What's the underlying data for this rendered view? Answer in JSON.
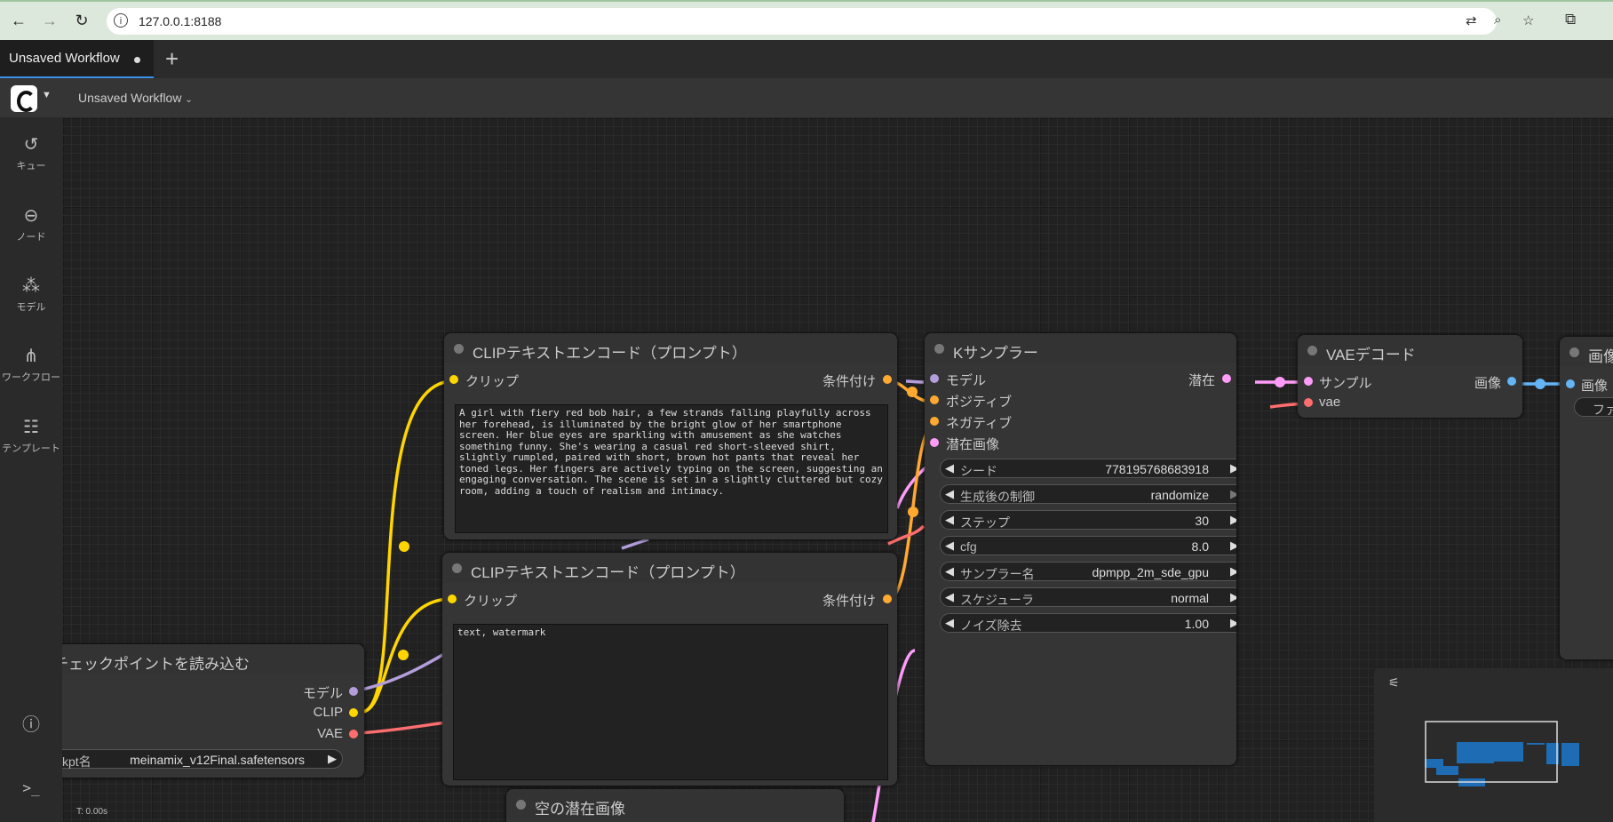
{
  "browser": {
    "url": "127.0.0.1:8188",
    "back_icon": "back-arrow-icon",
    "forward_icon": "forward-arrow-icon",
    "reload_icon": "reload-icon"
  },
  "tabs": [
    {
      "label": "Unsaved Workflow",
      "active": true,
      "modified": true
    }
  ],
  "menubar": {
    "workflow_name": "Unsaved Workflow"
  },
  "sidebar": {
    "items": [
      {
        "label": "キュー",
        "icon": "history-icon"
      },
      {
        "label": "ノード",
        "icon": "node-icon"
      },
      {
        "label": "モデル",
        "icon": "model-icon"
      },
      {
        "label": "ワークフロー",
        "icon": "workflow-icon"
      },
      {
        "label": "テンプレート",
        "icon": "template-icon"
      }
    ],
    "help_icon": "help-icon",
    "terminal_icon": "terminal-icon"
  },
  "nodes": {
    "clip_pos": {
      "title": "CLIPテキストエンコード（プロンプト）",
      "input": "クリップ",
      "output": "条件付け",
      "text": "A girl with fiery red bob hair, a few strands falling playfully across her forehead, is illuminated by the bright glow of her smartphone screen. Her blue eyes are sparkling with amusement as she watches something funny. She's wearing a casual red short-sleeved shirt, slightly rumpled, paired with short, brown hot pants that reveal her toned legs. Her fingers are actively typing on the screen, suggesting an engaging conversation. The scene is set in a slightly cluttered but cozy room, adding a touch of realism and intimacy."
    },
    "clip_neg": {
      "title": "CLIPテキストエンコード（プロンプト）",
      "input": "クリップ",
      "output": "条件付け",
      "text": "text, watermark"
    },
    "ksampler": {
      "title": "Kサンプラー",
      "inputs": [
        "モデル",
        "ポジティブ",
        "ネガティブ",
        "潜在画像"
      ],
      "output": "潜在",
      "widgets": [
        {
          "label": "シード",
          "value": "778195768683918"
        },
        {
          "label": "生成後の制御",
          "value": "randomize"
        },
        {
          "label": "ステップ",
          "value": "30"
        },
        {
          "label": "cfg",
          "value": "8.0"
        },
        {
          "label": "サンプラー名",
          "value": "dpmpp_2m_sde_gpu"
        },
        {
          "label": "スケジューラ",
          "value": "normal"
        },
        {
          "label": "ノイズ除去",
          "value": "1.00"
        }
      ]
    },
    "vae_decode": {
      "title": "VAEデコード",
      "inputs": [
        "サンプル",
        "vae"
      ],
      "output": "画像"
    },
    "save_image": {
      "title": "画像",
      "input": "画像",
      "widget": "ファ"
    },
    "checkpoint": {
      "title": "チェックポイントを読み込む",
      "outputs": [
        "モデル",
        "CLIP",
        "VAE"
      ],
      "widget_label": "ckpt名",
      "widget_value": "meinamix_v12Final.safetensors"
    },
    "empty_latent": {
      "title": "空の潜在画像"
    }
  },
  "status": {
    "timer": "T: 0.00s"
  },
  "colors": {
    "clip": "#ffd500",
    "conditioning": "#ffa931",
    "model": "#b39ddb",
    "latent": "#ff9cf9",
    "vae": "#ff6e6e",
    "image": "#64b5f6"
  }
}
